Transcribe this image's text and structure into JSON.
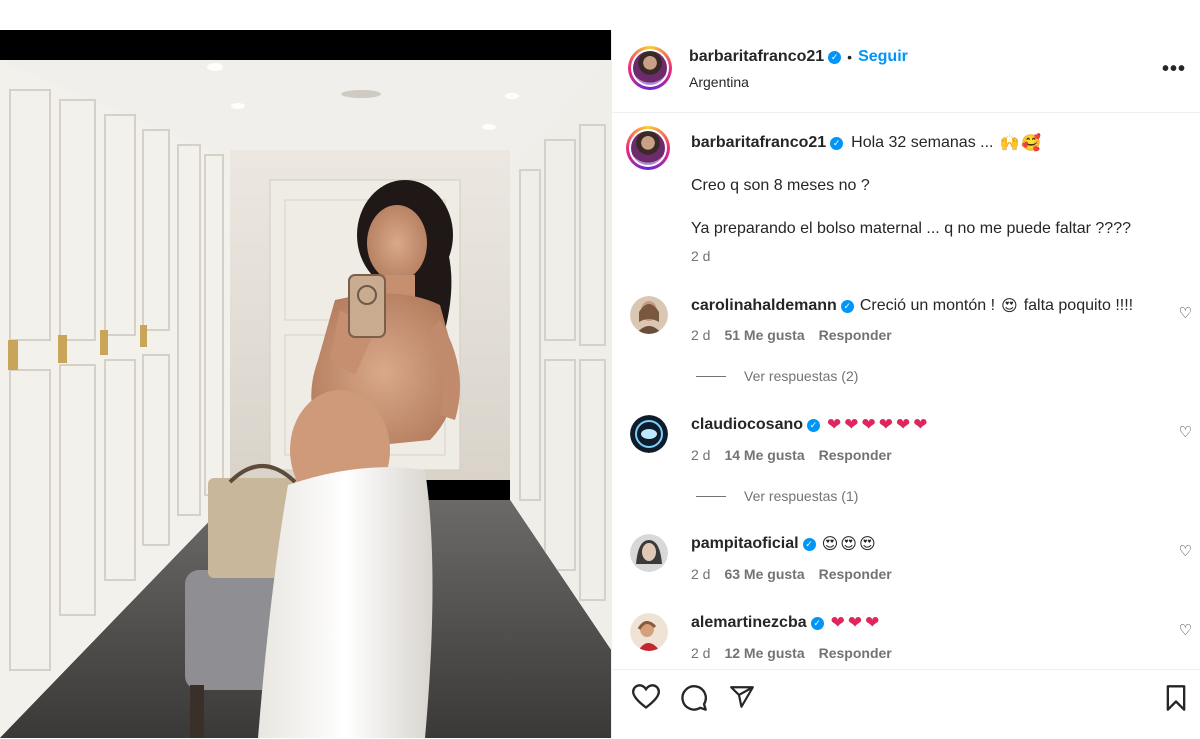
{
  "post": {
    "username": "barbaritafranco21",
    "follow_label": "Seguir",
    "separator": "•",
    "location": "Argentina",
    "more_label": "•••",
    "verified_mark": "✓"
  },
  "caption": {
    "username": "barbaritafranco21",
    "line1": "Hola 32 semanas ...",
    "line2": "Creo q son 8 meses no ?",
    "line3": "Ya preparando el bolso maternal ... q no me puede faltar ????",
    "time": "2 d",
    "emojis": [
      "raised-hands",
      "smiling-hearts"
    ]
  },
  "comments": [
    {
      "username": "carolinahaldemann",
      "text_before": "Creció un montón !",
      "text_after": "falta poquito !!!!",
      "emojis": [
        "heart-eyes"
      ],
      "time": "2 d",
      "likes": "51 Me gusta",
      "reply_label": "Responder",
      "view_replies": "Ver respuestas (2)"
    },
    {
      "username": "claudiocosano",
      "hearts": [
        "❤",
        "❤",
        "❤",
        "❤",
        "❤",
        "❤"
      ],
      "time": "2 d",
      "likes": "14 Me gusta",
      "reply_label": "Responder",
      "view_replies": "Ver respuestas (1)"
    },
    {
      "username": "pampitaoficial",
      "faces": [
        "😍",
        "😍",
        "😍"
      ],
      "time": "2 d",
      "likes": "63 Me gusta",
      "reply_label": "Responder"
    },
    {
      "username": "alemartinezcba",
      "hearts": [
        "❤",
        "❤",
        "❤"
      ],
      "time": "2 d",
      "likes": "12 Me gusta",
      "reply_label": "Responder"
    }
  ],
  "icons": {
    "like": "heart-outline-icon",
    "comment": "comment-bubble-icon",
    "share": "paper-plane-icon",
    "save": "bookmark-icon",
    "comment_like": "small-heart-icon",
    "verified": "verified-badge-icon"
  },
  "colors": {
    "link_blue": "#0095f6",
    "verified_blue": "#0095f6",
    "secondary_text": "#737373",
    "primary_text": "#262626"
  }
}
